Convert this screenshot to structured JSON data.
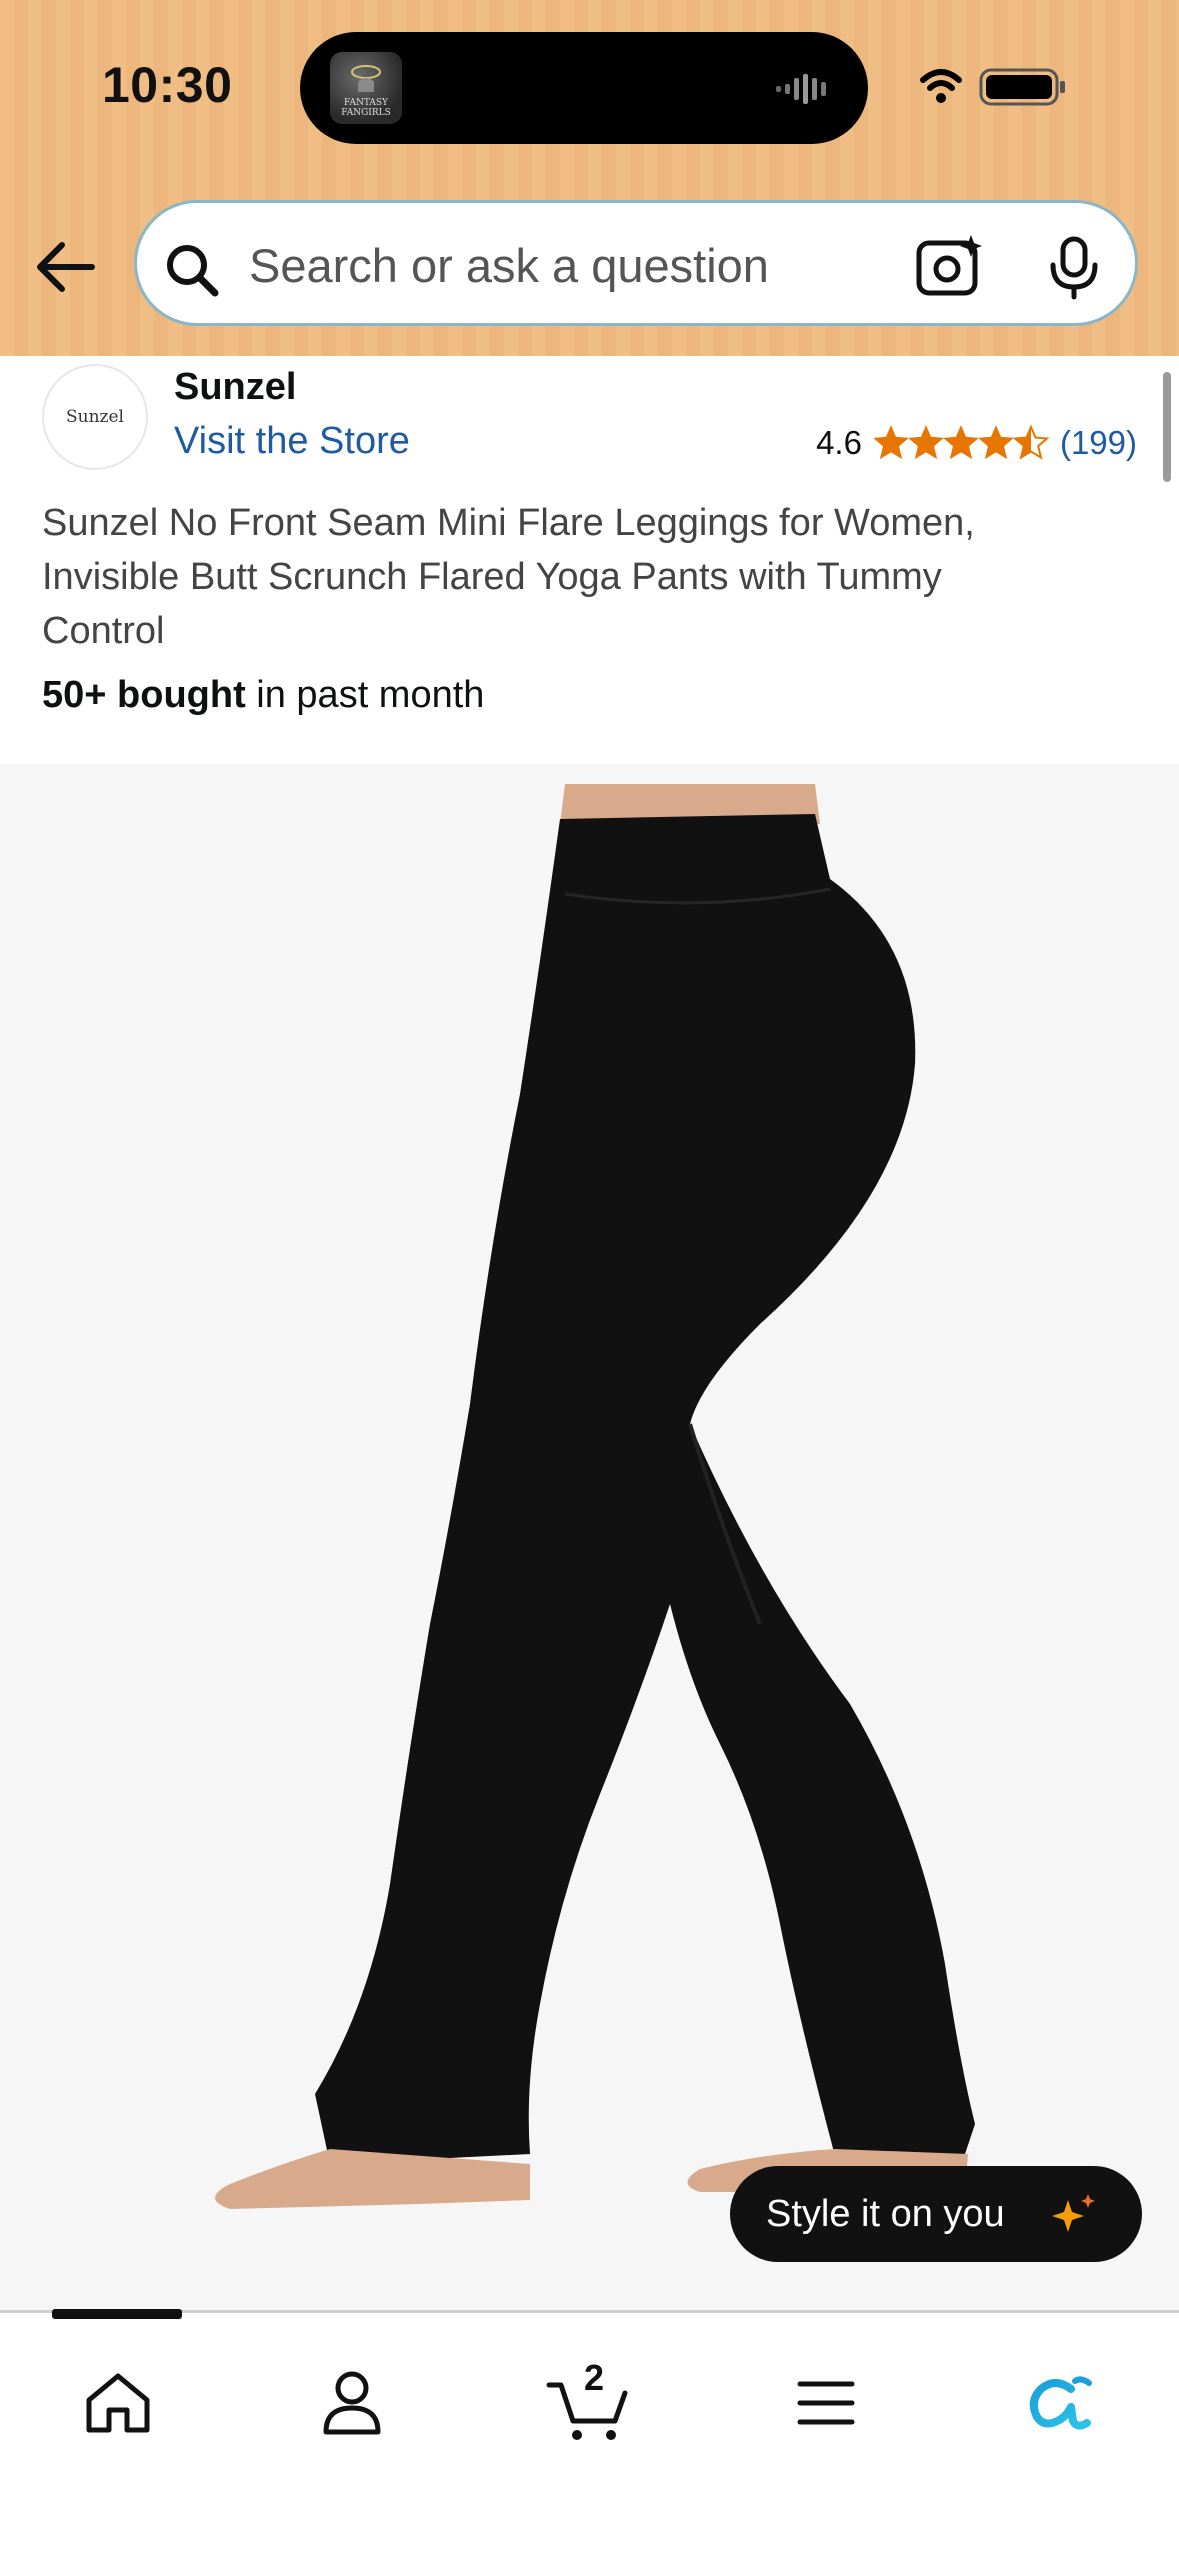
{
  "status_bar": {
    "time": "10:30",
    "now_playing_art_text": "FANTASY FANGIRLS",
    "icons": [
      "wifi-icon",
      "battery-icon"
    ]
  },
  "search": {
    "placeholder": "Search or ask a question",
    "icons": [
      "back-arrow-icon",
      "search-icon",
      "camera-lens-icon",
      "microphone-icon"
    ]
  },
  "brand": {
    "logo_text": "Sunzel",
    "name": "Sunzel",
    "visit_store": "Visit the Store"
  },
  "rating": {
    "value": "4.6",
    "stars": 4.5,
    "count": "(199)",
    "star_color": "#e77600"
  },
  "product": {
    "title": "Sunzel No Front Seam Mini Flare Leggings for Women, Invisible Butt Scrunch Flared Yoga Pants with Tummy Control",
    "bought_bold": "50+ bought",
    "bought_rest": " in past month"
  },
  "image": {
    "description_icon": "product-photo-leggings"
  },
  "style_button": {
    "label": "Style it on you",
    "sparkle_color": "#f59e0b"
  },
  "bottom_nav": {
    "items": [
      "home-icon",
      "account-icon",
      "cart-icon",
      "menu-icon",
      "rufus-ai-icon"
    ],
    "cart_count": "2",
    "active": "home"
  },
  "colors": {
    "header_bg": "#f0bd85",
    "link": "#1f5aa3",
    "ai_blue": "#1a9fd8"
  }
}
